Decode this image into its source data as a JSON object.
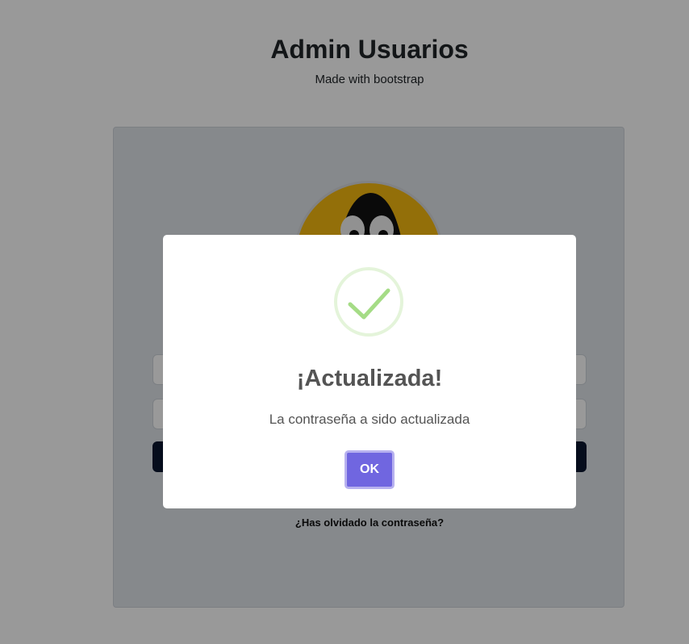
{
  "header": {
    "title": "Admin Usuarios",
    "subtitle": "Made with bootstrap"
  },
  "login": {
    "forgot_link": "¿Has olvidado la contraseña?"
  },
  "dialog": {
    "icon": "success-check-icon",
    "title": "¡Actualizada!",
    "text": "La contraseña a sido actualizada",
    "ok_label": "OK"
  },
  "colors": {
    "confirm_button": "#7066e0",
    "success_check": "#a5dc86",
    "avatar_background": "#f5b90f",
    "submit_button": "#0b1730"
  }
}
